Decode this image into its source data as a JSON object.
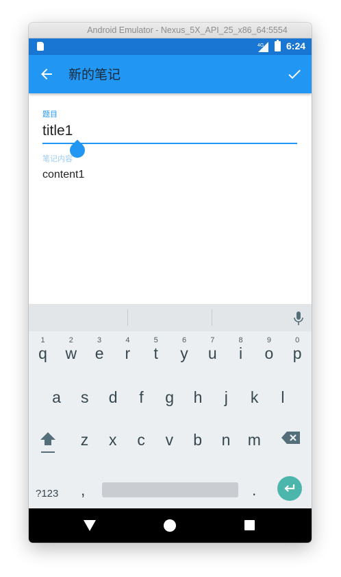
{
  "window": {
    "title": "Android Emulator - Nexus_5X_API_25_x86_64:5554"
  },
  "status_bar": {
    "time": "6:24",
    "network": "4G"
  },
  "app_bar": {
    "title": "新的笔记",
    "back_icon": "arrow-back-icon",
    "confirm_icon": "check-icon"
  },
  "form": {
    "title_label": "题目",
    "title_value": "title1",
    "content_label": "笔记内容",
    "content_value": "content1"
  },
  "keyboard": {
    "number_hints": [
      "1",
      "2",
      "3",
      "4",
      "5",
      "6",
      "7",
      "8",
      "9",
      "0"
    ],
    "row1": [
      "q",
      "w",
      "e",
      "r",
      "t",
      "y",
      "u",
      "i",
      "o",
      "p"
    ],
    "row2": [
      "a",
      "s",
      "d",
      "f",
      "g",
      "h",
      "j",
      "k",
      "l"
    ],
    "row3": [
      "z",
      "x",
      "c",
      "v",
      "b",
      "n",
      "m"
    ],
    "symbols_label": "?123",
    "comma": ",",
    "period": ".",
    "accent_color": "#4db6ac"
  },
  "colors": {
    "status_bar": "#1976D2",
    "app_bar": "#2196F3",
    "accent": "#2196F3"
  }
}
